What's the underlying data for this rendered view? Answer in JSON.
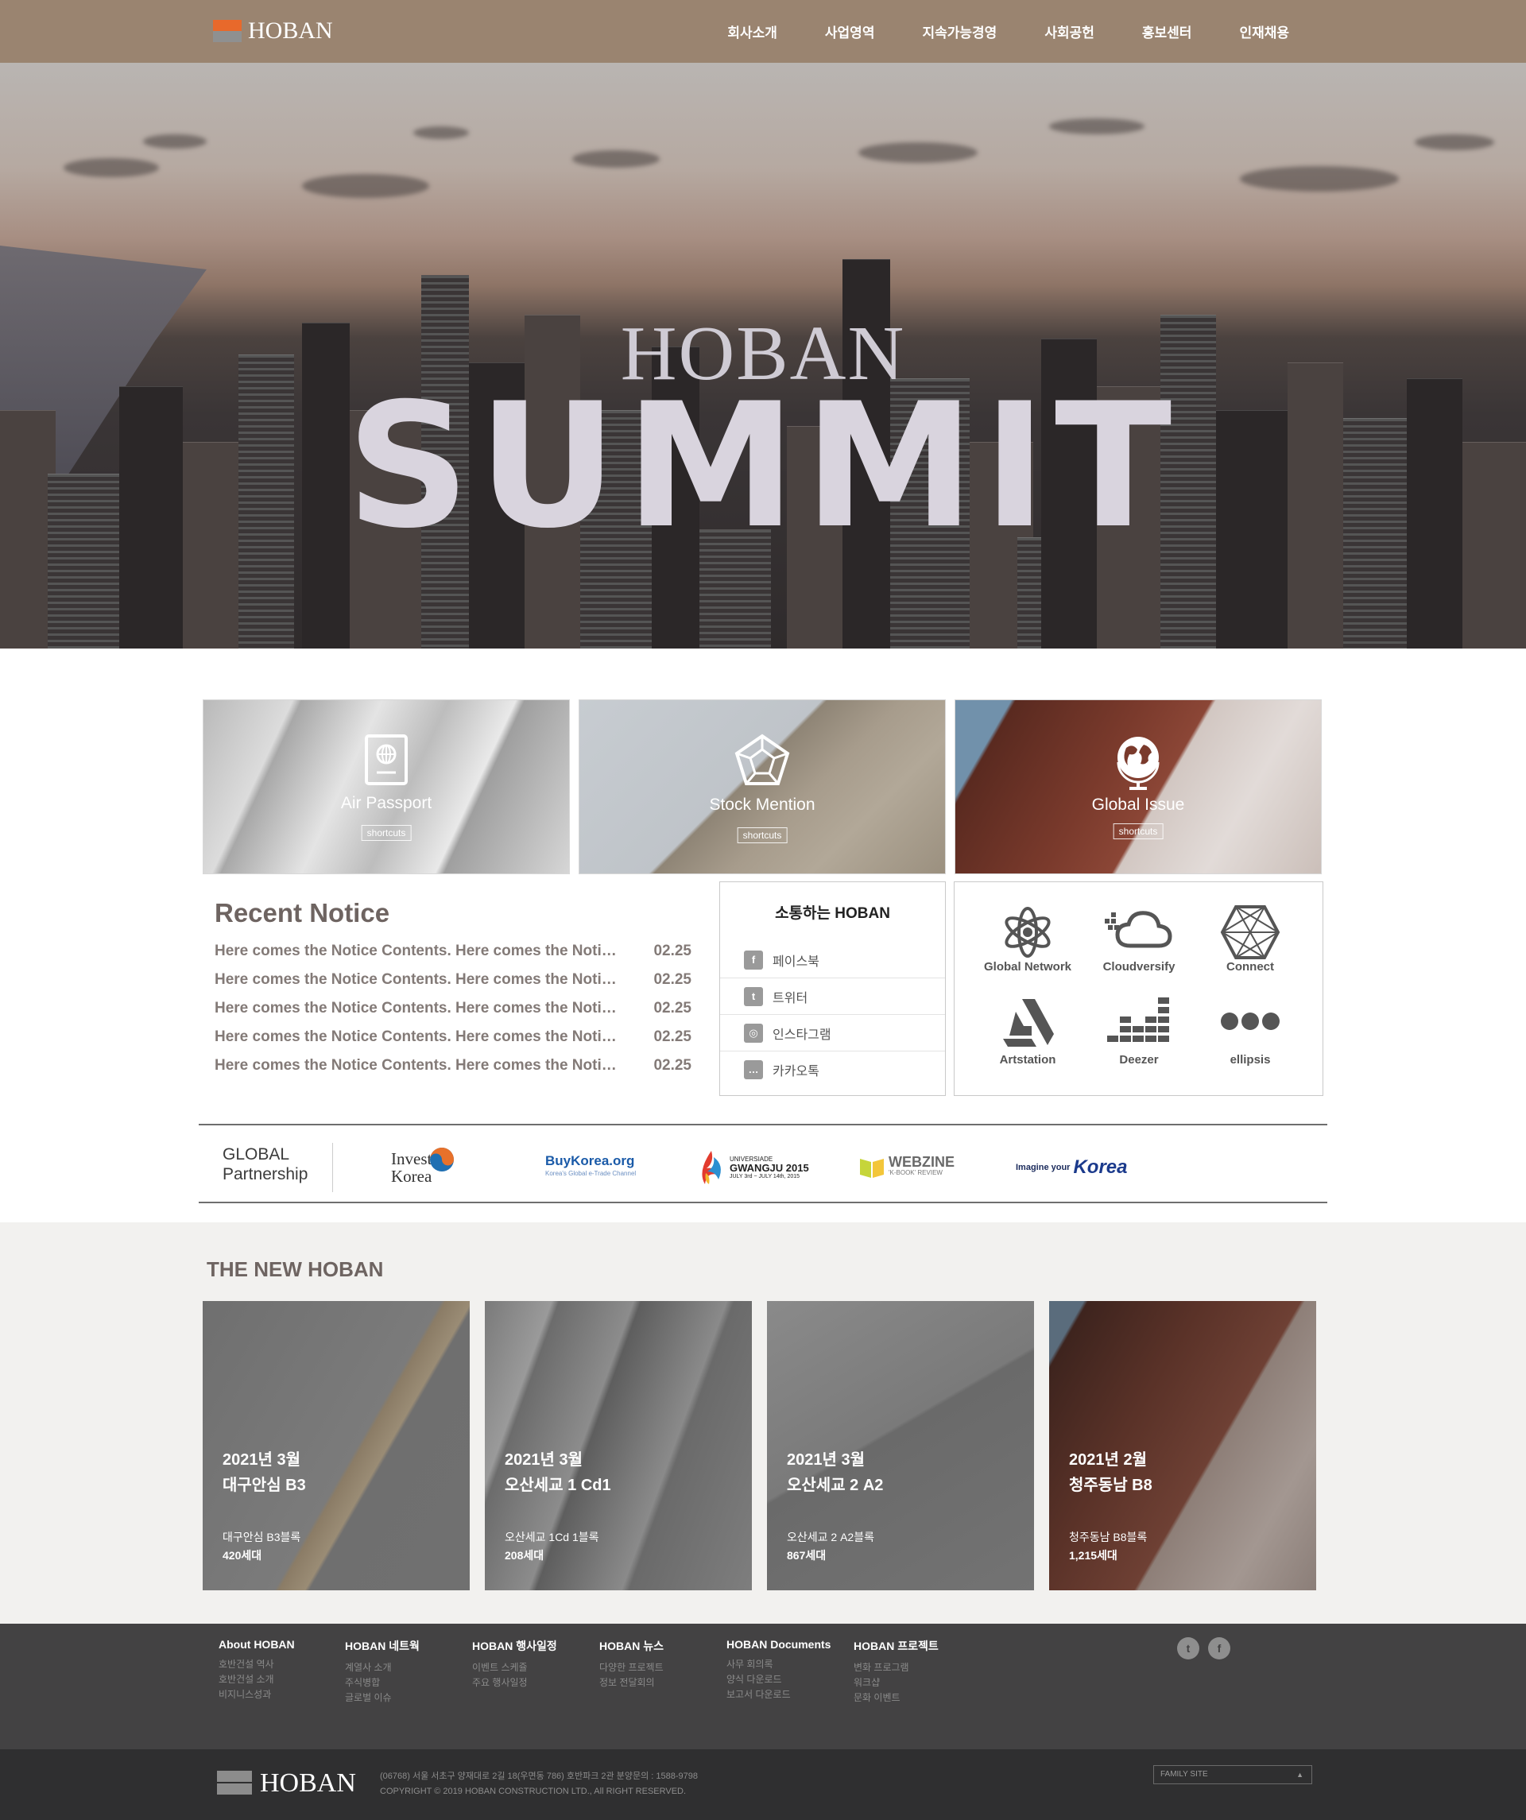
{
  "header": {
    "logo_text": "HOBAN",
    "nav": [
      "회사소개",
      "사업영역",
      "지속가능경영",
      "사회공헌",
      "홍보센터",
      "인재채용"
    ]
  },
  "hero": {
    "title_line1": "HOBAN",
    "title_line2": "SUMMIT"
  },
  "shortcuts": [
    {
      "label": "Air Passport",
      "button": "shortcuts",
      "icon": "passport-icon"
    },
    {
      "label": "Stock Mention",
      "button": "shortcuts",
      "icon": "pentagon-icon"
    },
    {
      "label": "Global Issue",
      "button": "shortcuts",
      "icon": "globe-icon"
    }
  ],
  "notice": {
    "title": "Recent Notice",
    "items": [
      {
        "text": "Here comes the Notice Contents. Here comes the Notice Contents.",
        "date": "02.25"
      },
      {
        "text": "Here comes the Notice Contents. Here comes the Notice Contents.",
        "date": "02.25"
      },
      {
        "text": "Here comes the Notice Contents. Here comes the Notice Contents.",
        "date": "02.25"
      },
      {
        "text": "Here comes the Notice Contents. Here comes the Notice Contents.",
        "date": "02.25"
      },
      {
        "text": "Here comes the Notice Contents. Here comes the Notice Contents.",
        "date": "02.25"
      }
    ]
  },
  "sns": {
    "title": "소통하는 HOBAN",
    "items": [
      {
        "label": "페이스북",
        "icon": "facebook-icon"
      },
      {
        "label": "트위터",
        "icon": "twitter-icon"
      },
      {
        "label": "인스타그램",
        "icon": "instagram-icon"
      },
      {
        "label": "카카오톡",
        "icon": "kakaotalk-icon"
      }
    ]
  },
  "icon_grid": [
    {
      "label": "Global Network",
      "icon": "atom-icon"
    },
    {
      "label": "Cloudversify",
      "icon": "cloud-icon"
    },
    {
      "label": "Connect",
      "icon": "hexagon-icon"
    },
    {
      "label": "Artstation",
      "icon": "artstation-icon"
    },
    {
      "label": "Deezer",
      "icon": "deezer-icon"
    },
    {
      "label": "ellipsis",
      "icon": "ellipsis-icon"
    }
  ],
  "partners": {
    "title_line1": "GLOBAL",
    "title_line2": "Partnership",
    "logos": [
      {
        "name": "Invest Korea",
        "line1": "Invest",
        "line2": "Korea"
      },
      {
        "name": "BuyKorea.org",
        "line1": "BuyKorea.org",
        "line2": "Korea's Global e-Trade Channel"
      },
      {
        "name": "Gwangju 2015",
        "line1": "UNIVERSIADE",
        "line2": "GWANGJU 2015",
        "line3": "JULY 3rd ~ JULY 14th, 2015"
      },
      {
        "name": "Webzine",
        "line1": "WEBZINE",
        "line2": "'K-BOOK' REVIEW"
      },
      {
        "name": "Imagine your Korea",
        "line1": "Imagine your",
        "line2": "Korea"
      }
    ]
  },
  "new_hoban": {
    "title": "THE NEW HOBAN",
    "cards": [
      {
        "date": "2021년 3월",
        "name": "대구안심 B3",
        "block": "대구안심 B3블록",
        "units": "420세대"
      },
      {
        "date": "2021년 3월",
        "name": "오산세교 1 Cd1",
        "block": "오산세교 1Cd 1블록",
        "units": "208세대"
      },
      {
        "date": "2021년 3월",
        "name": "오산세교 2 A2",
        "block": "오산세교 2 A2블록",
        "units": "867세대"
      },
      {
        "date": "2021년 2월",
        "name": "청주동남 B8",
        "block": "청주동남 B8블록",
        "units": "1,215세대"
      }
    ]
  },
  "footer": {
    "columns": [
      {
        "heading": "About HOBAN",
        "items": [
          "호반건설 역사",
          "호반건설 소개",
          "비지니스성과"
        ]
      },
      {
        "heading": "HOBAN 네트웍",
        "items": [
          "계열사 소개",
          "주식병합",
          "글로벌 이슈"
        ]
      },
      {
        "heading": "HOBAN 행사일정",
        "items": [
          "이벤트 스케쥴",
          "주요 행사일정"
        ]
      },
      {
        "heading": "HOBAN 뉴스",
        "items": [
          "다양한 프로젝트",
          "정보 전달회의"
        ]
      },
      {
        "heading": "HOBAN Documents",
        "items": [
          "사무 회의록",
          "양식 다운로드",
          "보고서 다운로드"
        ]
      },
      {
        "heading": "HOBAN 프로젝트",
        "items": [
          "변화 프로그램",
          "워크샵",
          "문화 이벤트"
        ]
      }
    ],
    "social": [
      {
        "icon": "twitter-icon",
        "glyph": "t"
      },
      {
        "icon": "facebook-icon",
        "glyph": "f"
      }
    ],
    "logo_text": "HOBAN",
    "address": "(06768) 서울 서초구 양재대로 2길 18(우면동 786) 호반파크 2관 분양문의 : 1588-9798",
    "copyright": "COPYRIGHT © 2019 HOBAN CONSTRUCTION LTD., All RIGHT RESERVED.",
    "family_site": "FAMILY SITE"
  }
}
